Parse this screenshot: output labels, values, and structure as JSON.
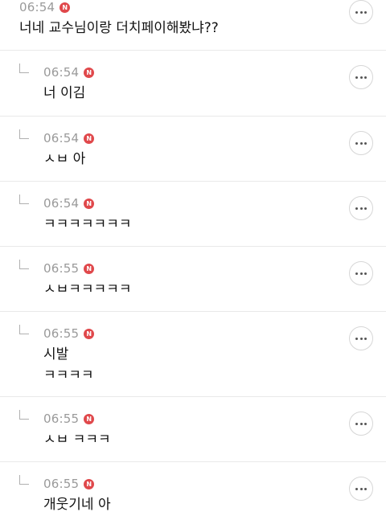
{
  "comments": [
    {
      "time": "06:54",
      "badge": "N",
      "lines": [
        "너네 교수님이랑 더치페이해봤냐??"
      ]
    },
    {
      "time": "06:54",
      "badge": "N",
      "lines": [
        "너 이김"
      ]
    },
    {
      "time": "06:54",
      "badge": "N",
      "lines": [
        "ㅅㅂ 아"
      ]
    },
    {
      "time": "06:54",
      "badge": "N",
      "lines": [
        "ㅋㅋㅋㅋㅋㅋㅋ"
      ]
    },
    {
      "time": "06:55",
      "badge": "N",
      "lines": [
        "ㅅㅂㅋㅋㅋㅋㅋ"
      ]
    },
    {
      "time": "06:55",
      "badge": "N",
      "lines": [
        "시발",
        "ㅋㅋㅋㅋ"
      ]
    },
    {
      "time": "06:55",
      "badge": "N",
      "lines": [
        "ㅅㅂ ㅋㅋㅋ"
      ]
    },
    {
      "time": "06:55",
      "badge": "N",
      "lines": [
        "개웃기네 아"
      ]
    }
  ],
  "icons": {
    "reply": "reply-arrow-icon",
    "more": "more-options-icon",
    "new": "new-badge-icon"
  },
  "colors": {
    "badge": "#e0484b",
    "time": "#9a9a9a",
    "divider": "#e9e9e9"
  }
}
